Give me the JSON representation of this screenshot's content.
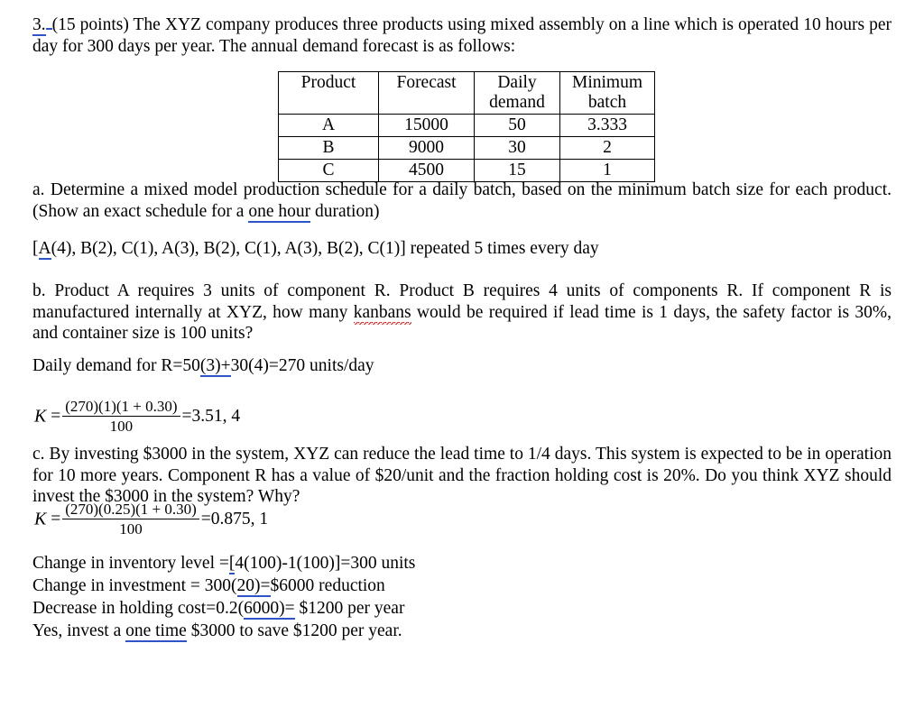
{
  "document": {
    "question_number": "3.",
    "intro": {
      "points": "(15 points)",
      "line": "The XYZ company produces three products using mixed assembly on a line which is operated 10 hours per day for 300 days per year.  The annual demand forecast is as follows:"
    },
    "table": {
      "headers": [
        "Product",
        "Forecast",
        "Daily demand",
        "Minimum batch"
      ],
      "header_parts": {
        "h1": "Product",
        "h2": "Forecast",
        "h3a": "Daily",
        "h3b": "demand",
        "h4a": "Minimum",
        "h4b": "batch"
      },
      "rows": [
        {
          "product": "A",
          "forecast": "15000",
          "daily_demand": "50",
          "minimum_batch": "3.333"
        },
        {
          "product": "B",
          "forecast": "9000",
          "daily_demand": "30",
          "minimum_batch": "2"
        },
        {
          "product": "C",
          "forecast": "4500",
          "daily_demand": "15",
          "minimum_batch": "1"
        }
      ]
    },
    "part_a": {
      "text_1": "a.  Determine a mixed model production schedule for a daily batch, based on the minimum batch size for each product.  (Show an exact schedule for a ",
      "underlined": "one hour",
      "text_2": " duration)",
      "answer_prefix": "[",
      "answer_underlined": "A",
      "answer_rest": "(4), B(2), C(1), A(3), B(2), C(1), A(3), B(2), C(1)]  repeated 5 times every day"
    },
    "part_b": {
      "text_1": "b.  Product A requires 3 units of component R.  Product B requires 4 units of components R.  If component R is manufactured internally at XYZ, how many ",
      "misspelled": "kanbans",
      "text_2": " would be required if lead time is 1 days, the safety factor is 30%, and container size is 100 units?",
      "demand_line": {
        "prefix": "Daily demand for R=50",
        "underlined": "(3)+",
        "suffix": "30(4)=270 units/day"
      },
      "formula": {
        "variable": "K",
        "equals": "=",
        "numerator": "(270)(1)(1 + 0.30)",
        "denominator": "100",
        "result": "=3.51, 4"
      }
    },
    "part_c": {
      "text": "c.  By investing $3000 in the system, XYZ can reduce the lead time to 1/4 days.  This system is expected to be in operation for 10 more years.  Component R has a value of $20/unit and the fraction holding cost is 20%.  Do you think XYZ should invest the $3000 in the system?  Why?",
      "formula": {
        "variable": "K",
        "equals": "=",
        "numerator": "(270)(0.25)(1 + 0.30)",
        "denominator": "100",
        "result": "=0.875, 1"
      },
      "conclusion_lines": [
        {
          "pre": "Change in inventory level =",
          "underlined": "[",
          "post": "4(100)-1(100)]=300 units"
        },
        {
          "pre": "Change in investment = 300(",
          "underlined": "20)=",
          "post": "$6000 reduction"
        },
        {
          "pre": "Decrease in holding cost=0.2(",
          "underlined": "6000)=",
          "post": " $1200 per year"
        },
        {
          "pre": "Yes, invest a ",
          "underlined": "one time",
          "post": " $3000 to save $1200 per year."
        }
      ]
    },
    "colors": {
      "text": "#000000",
      "edit_underline": "#2f54c8",
      "spellcheck_squiggle": "#d21c1c",
      "background": "#ffffff"
    }
  }
}
